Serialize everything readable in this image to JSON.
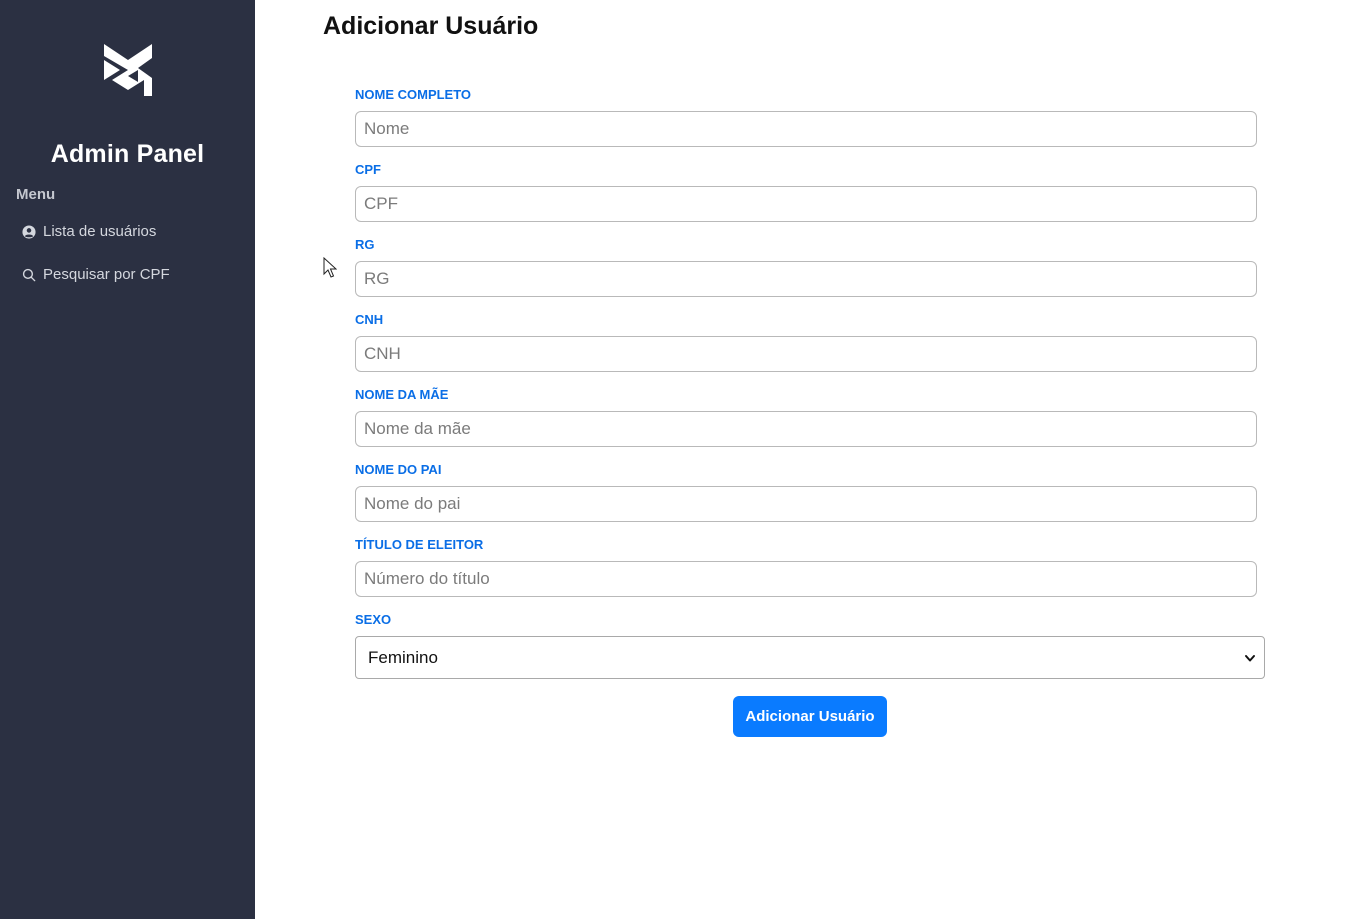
{
  "sidebar": {
    "logo_icon": "brand-monogram-icon",
    "brand": "Admin Panel",
    "menu_heading": "Menu",
    "items": [
      {
        "icon": "user-circle-icon",
        "label": "Lista de usuários"
      },
      {
        "icon": "search-icon",
        "label": "Pesquisar por CPF"
      }
    ],
    "background": "#2b3042"
  },
  "main": {
    "title": "Adicionar Usuário",
    "form": {
      "fields": [
        {
          "label": "NOME COMPLETO",
          "placeholder": "Nome",
          "value": ""
        },
        {
          "label": "CPF",
          "placeholder": "CPF",
          "value": ""
        },
        {
          "label": "RG",
          "placeholder": "RG",
          "value": ""
        },
        {
          "label": "CNH",
          "placeholder": "CNH",
          "value": ""
        },
        {
          "label": "NOME DA MÃE",
          "placeholder": "Nome da mãe",
          "value": ""
        },
        {
          "label": "NOME DO PAI",
          "placeholder": "Nome do pai",
          "value": ""
        },
        {
          "label": "TÍTULO DE ELEITOR",
          "placeholder": "Número do título",
          "value": ""
        }
      ],
      "sexo": {
        "label": "SEXO",
        "selected": "Feminino",
        "icon": "chevron-down-icon"
      },
      "submit_label": "Adicionar Usuário"
    },
    "label_color": "#0a6ee6",
    "accent": "#0a7bff"
  }
}
